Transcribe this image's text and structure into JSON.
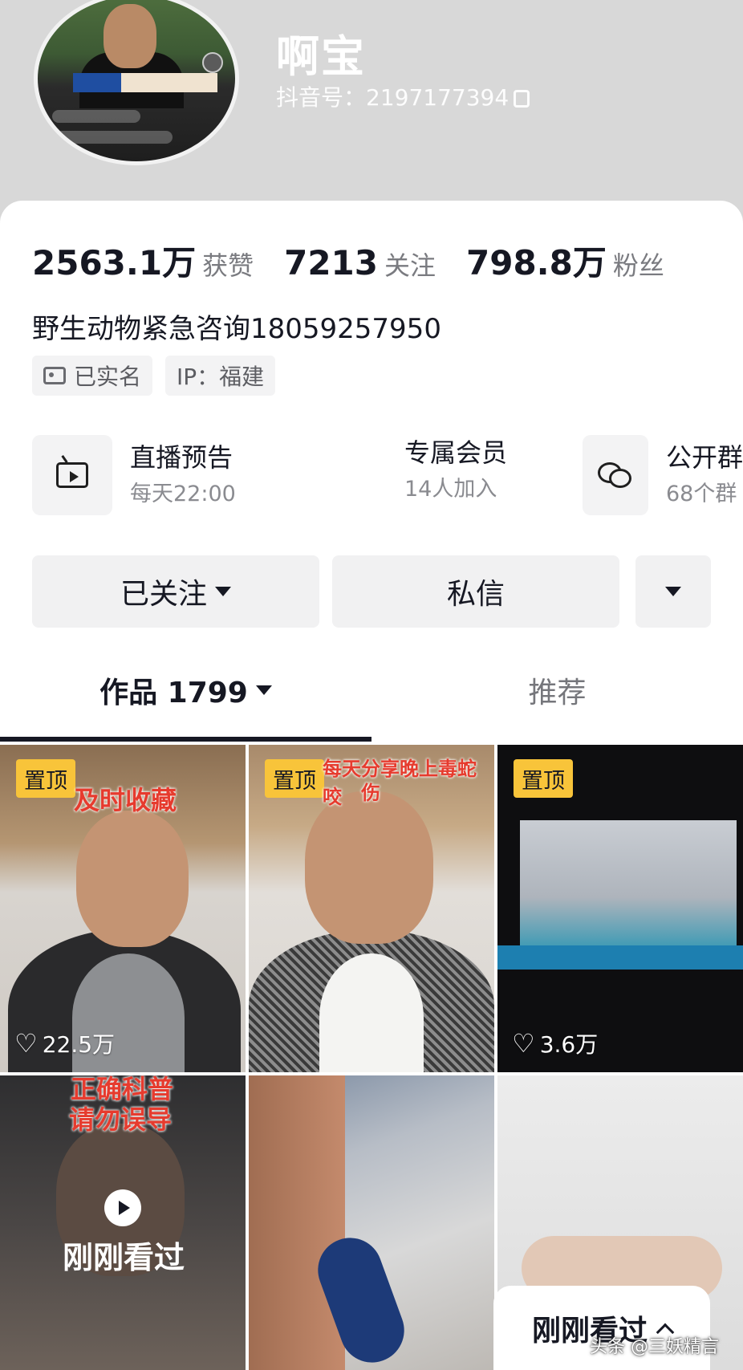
{
  "profile": {
    "nickname": "啊宝",
    "douyin_id": "抖音号：2197177394"
  },
  "stats": [
    {
      "value": "2563.1万",
      "label": "获赞"
    },
    {
      "value": "7213",
      "label": "关注"
    },
    {
      "value": "798.8万",
      "label": "粉丝"
    }
  ],
  "bio": "野生动物紧急咨询18059257950",
  "tags": {
    "verified": "已实名",
    "ip": "IP：福建"
  },
  "features": {
    "live": {
      "title": "直播预告",
      "subtitle": "每天22:00",
      "icon": "tv-icon"
    },
    "member": {
      "title": "专属会员",
      "subtitle": "14人加入"
    },
    "group": {
      "title": "公开群",
      "subtitle": "68个群",
      "icon": "chat-icon"
    }
  },
  "actions": {
    "follow": "已关注",
    "message": "私信"
  },
  "tabs": {
    "works": "作品 1799",
    "recommend": "推荐"
  },
  "grid": {
    "pin_label": "置顶",
    "tiles": [
      {
        "overlay": "及时收藏",
        "likes": "22.5万",
        "pinned": true
      },
      {
        "overlay_top": "每天分享晚上毒蛇咬",
        "overlay_bottom": "伤",
        "pinned": true
      },
      {
        "likes": "3.6万",
        "pinned": true
      },
      {
        "overlay_top": "正确科普",
        "overlay_bottom": "请勿误导",
        "watched": "刚刚看过"
      },
      {},
      {}
    ]
  },
  "recent_button": "刚刚看过",
  "watermark": "头条 @三妖精言",
  "colors": {
    "pin": "#f8c43a",
    "text": "#161823",
    "muted": "#7a7b80"
  }
}
